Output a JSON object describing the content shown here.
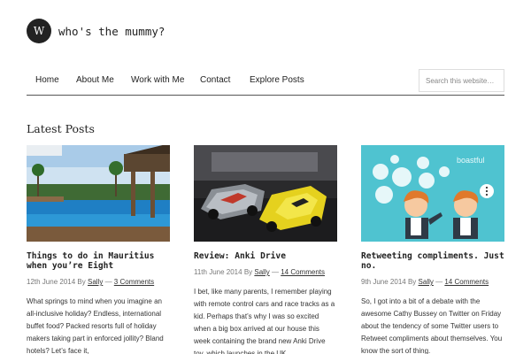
{
  "site": {
    "logo_letter": "W",
    "title": "who's the mummy?"
  },
  "nav": {
    "items": [
      {
        "label": "Home"
      },
      {
        "label": "About Me"
      },
      {
        "label": "Work with Me"
      },
      {
        "label": "Contact"
      },
      {
        "label": "Explore Posts"
      }
    ],
    "search_placeholder": "Search this website…"
  },
  "section_title": "Latest Posts",
  "posts": [
    {
      "title": "Things to do in Mauritius when you’re Eight",
      "date": "12th June 2014",
      "by": "By",
      "author": "Sally",
      "sep": "—",
      "comments": "3 Comments",
      "excerpt": "What springs to mind when you imagine an all-inclusive holiday? Endless, international buffet food? Packed resorts full of holiday makers taking part in enforced jollity? Bland hotels? Let’s face it,"
    },
    {
      "title": "Review: Anki Drive",
      "date": "11th June 2014",
      "by": "By",
      "author": "Sally",
      "sep": "—",
      "comments": "14 Comments",
      "excerpt": "I bet, like many parents, I remember playing with remote control cars and race tracks as a kid. Perhaps that’s why I was so excited when a big box arrived at our house this week containing the brand new Anki Drive toy, which launches in the UK …"
    },
    {
      "title": "Retweeting compliments. Just no.",
      "date": "9th June 2014",
      "by": "By",
      "author": "Sally",
      "sep": "—",
      "comments": "14 Comments",
      "excerpt": "So, I got into a bit of a debate with the awesome Cathy Bussey on Twitter on Friday about the tendency of some Twitter users to Retweet compliments about themselves. You know the sort of thing.",
      "image_text": "boastful"
    }
  ]
}
